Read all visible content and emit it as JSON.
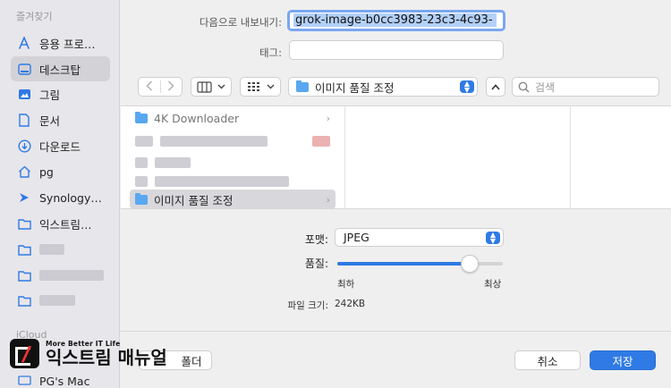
{
  "sidebar": {
    "favorites_heading": "즐겨찾기",
    "icloud_heading": "iCloud",
    "items": [
      {
        "label": "응용 프로…",
        "icon": "applications-icon"
      },
      {
        "label": "데스크탑",
        "icon": "desktop-icon",
        "selected": true
      },
      {
        "label": "그림",
        "icon": "pictures-icon"
      },
      {
        "label": "문서",
        "icon": "document-icon"
      },
      {
        "label": "다운로드",
        "icon": "download-icon"
      },
      {
        "label": "pg",
        "icon": "home-icon"
      },
      {
        "label": "Synology…",
        "icon": "synology-icon"
      },
      {
        "label": "익스트림…",
        "icon": "folder-icon"
      }
    ],
    "icloud_items": [
      {
        "label": "PG's Mac",
        "icon": "computer-icon"
      }
    ]
  },
  "form": {
    "export_label": "다음으로 내보내기:",
    "export_value": "grok-image-b0cc3983-23c3-4c93-",
    "tags_label": "태그:",
    "tags_value": ""
  },
  "toolbar": {
    "current_folder": "이미지 품질 조정",
    "search_placeholder": "검색"
  },
  "browser": {
    "rows": [
      {
        "label": "4K Downloader",
        "has_children": true
      },
      {
        "label": "이미지 품질 조정",
        "has_children": true,
        "selected": true
      }
    ]
  },
  "options": {
    "format_label": "포맷:",
    "format_value": "JPEG",
    "quality_label": "품질:",
    "quality_value": 0.8,
    "quality_min_label": "최하",
    "quality_max_label": "최상",
    "filesize_label": "파일 크기:",
    "filesize_value": "242KB"
  },
  "buttons": {
    "new_folder": "폴더",
    "cancel": "취소",
    "save": "저장"
  },
  "watermark": {
    "tagline": "More Better IT Life",
    "name": "익스트림 매뉴얼"
  },
  "colors": {
    "accent": "#2f7ae5",
    "selection": "#b3d0f7"
  }
}
